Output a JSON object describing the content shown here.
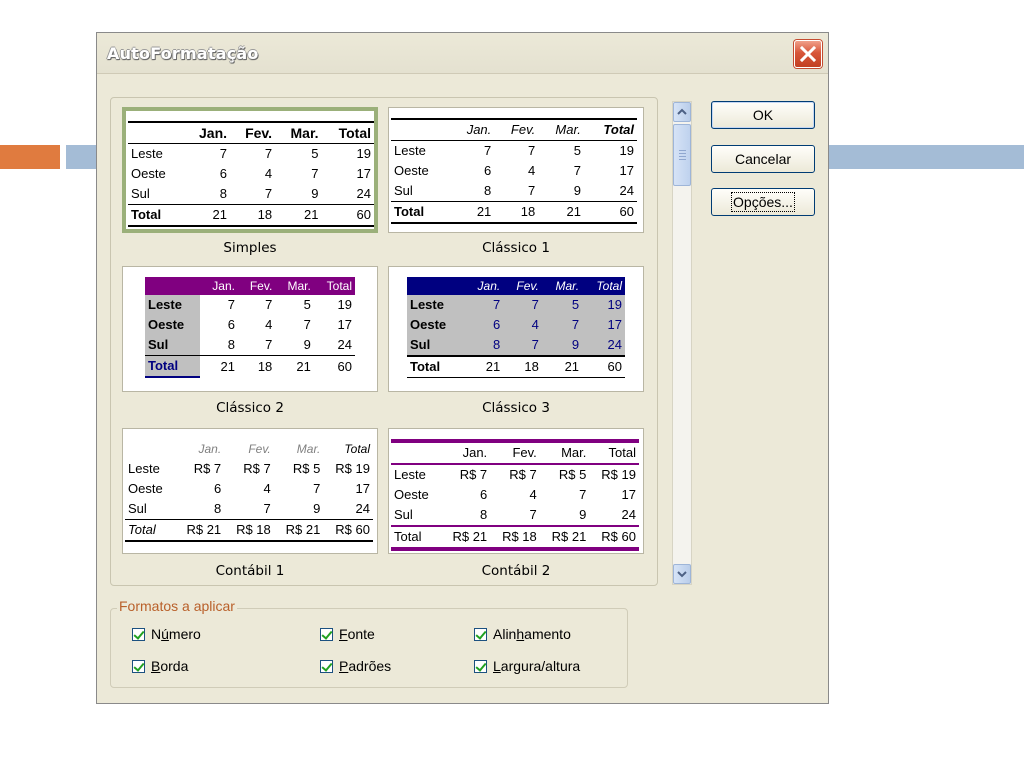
{
  "dialog": {
    "title": "AutoFormatação",
    "buttons": {
      "ok": "OK",
      "cancel": "Cancelar",
      "options": "Opções..."
    }
  },
  "table": {
    "months": [
      "Jan.",
      "Fev.",
      "Mar.",
      "Total"
    ],
    "rows": [
      {
        "label": "Leste",
        "values": [
          "7",
          "7",
          "5",
          "19"
        ]
      },
      {
        "label": "Oeste",
        "values": [
          "6",
          "4",
          "7",
          "17"
        ]
      },
      {
        "label": "Sul",
        "values": [
          "8",
          "7",
          "9",
          "24"
        ]
      }
    ],
    "total": {
      "label": "Total",
      "values": [
        "21",
        "18",
        "21",
        "60"
      ]
    },
    "acct": {
      "leste": [
        "R$  7",
        "R$  7",
        "R$  5",
        "R$ 19"
      ],
      "total": [
        "R$ 21",
        "R$ 18",
        "R$ 21",
        "R$ 60"
      ]
    }
  },
  "formats": {
    "simples": "Simples",
    "classico1": "Clássico 1",
    "classico2": "Clássico 2",
    "classico3": "Clássico 3",
    "contabil1": "Contábil 1",
    "contabil2": "Contábil 2"
  },
  "apply": {
    "legend": "Formatos a aplicar",
    "numero": {
      "pre": "N",
      "u": "ú",
      "post": "mero"
    },
    "fonte": {
      "pre": "",
      "u": "F",
      "post": "onte"
    },
    "alinhamento": {
      "pre": "Alin",
      "u": "h",
      "post": "amento"
    },
    "borda": {
      "pre": "",
      "u": "B",
      "post": "orda"
    },
    "padroes": {
      "pre": "",
      "u": "P",
      "post": "adrões"
    },
    "largura": {
      "pre": "",
      "u": "L",
      "post": "argura/altura"
    },
    "checked": true
  },
  "colors": {
    "purple": "#800080",
    "navy": "#000080",
    "selection": "#9bb07a",
    "legend": "#b9602a"
  },
  "icons": [
    "close-icon",
    "scroll-up-icon",
    "scroll-down-icon",
    "checkbox-checked-icon"
  ]
}
